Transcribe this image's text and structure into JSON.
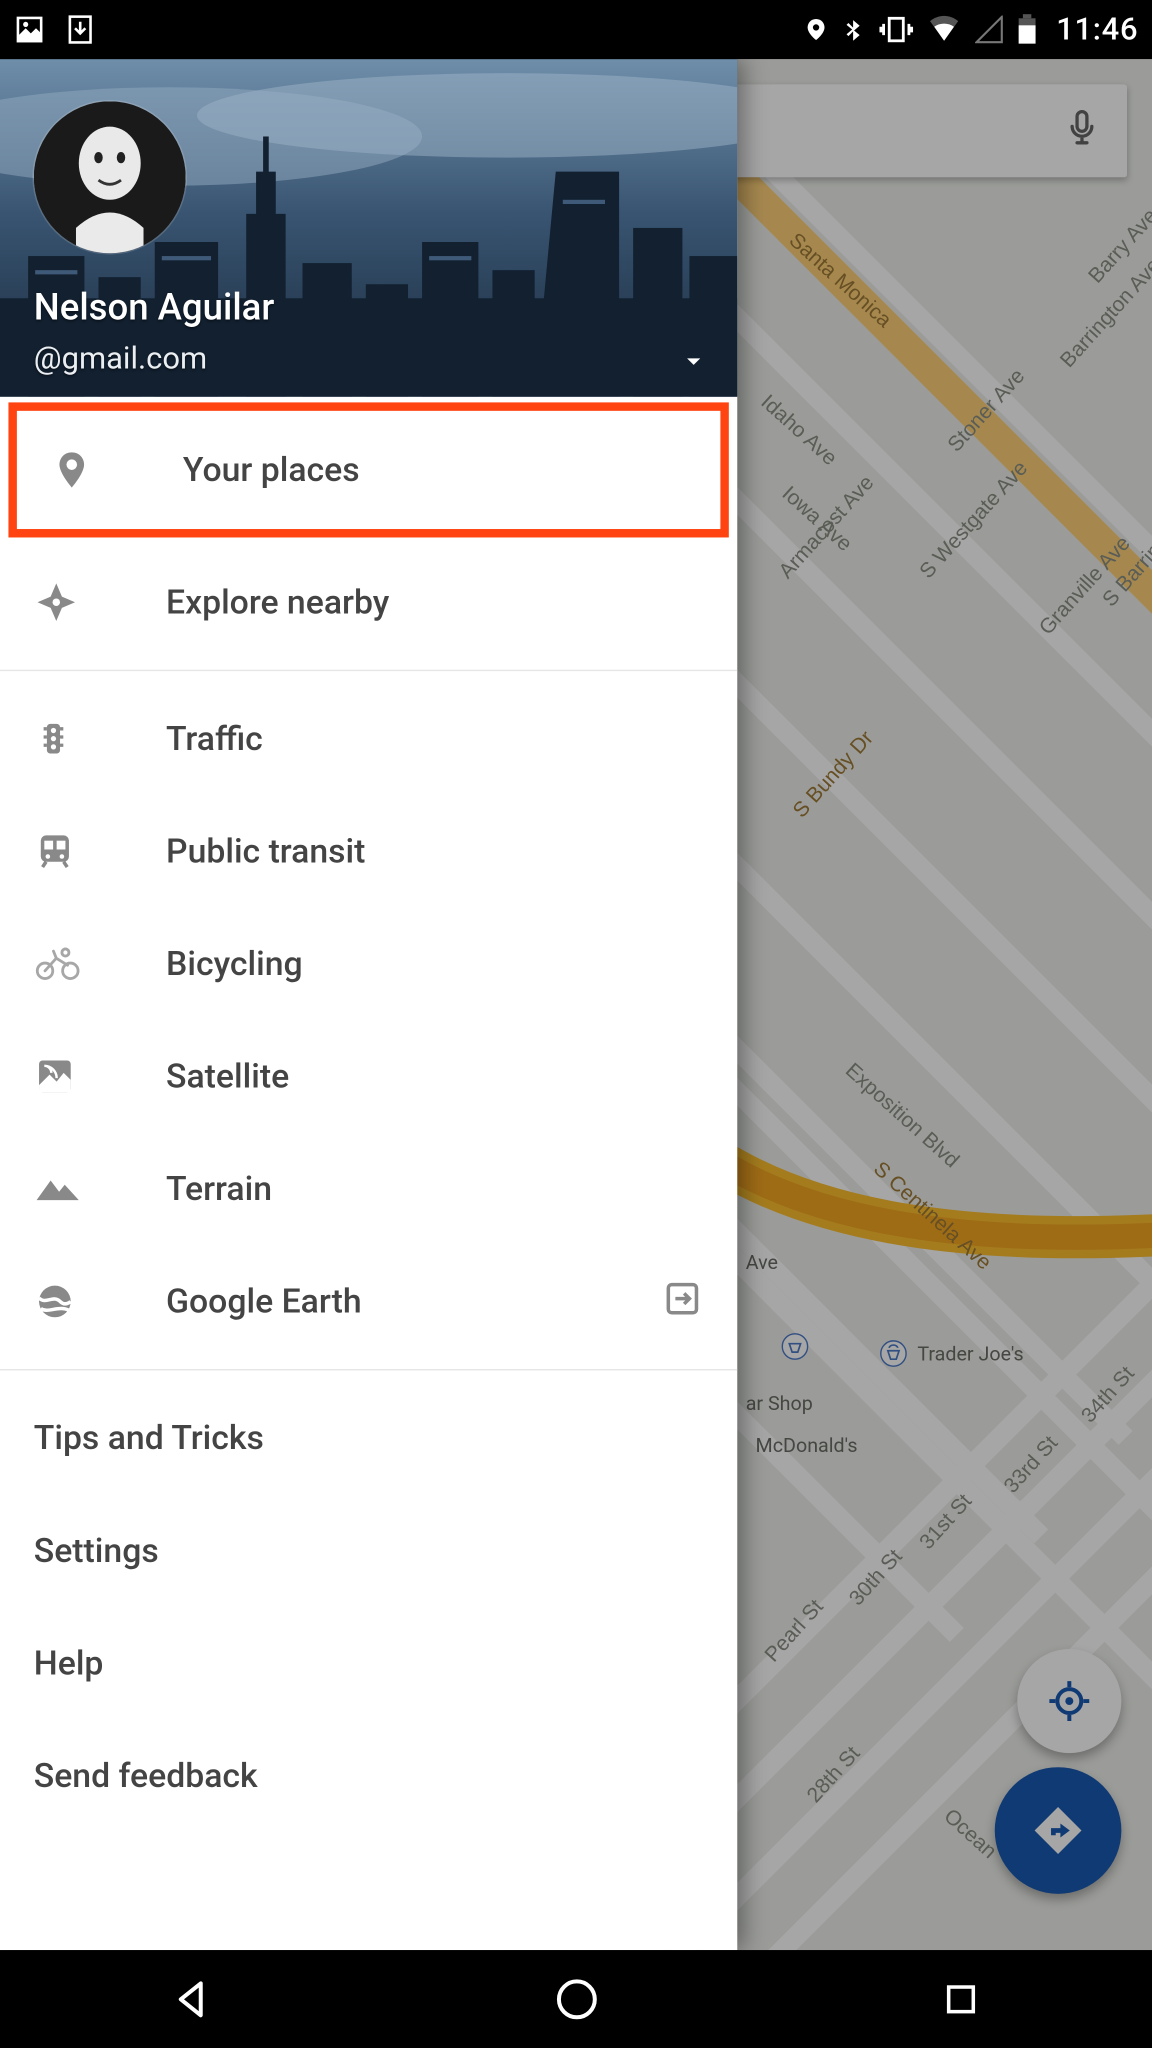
{
  "status_bar": {
    "time": "11:46"
  },
  "account": {
    "name": "Nelson Aguilar",
    "email": "@gmail.com"
  },
  "drawer": {
    "items_primary": [
      {
        "id": "your-places",
        "label": "Your places",
        "icon": "pin",
        "highlight": true
      },
      {
        "id": "explore-nearby",
        "label": "Explore nearby",
        "icon": "compass"
      }
    ],
    "items_layers": [
      {
        "id": "traffic",
        "label": "Traffic",
        "icon": "traffic"
      },
      {
        "id": "public-transit",
        "label": "Public transit",
        "icon": "transit"
      },
      {
        "id": "bicycling",
        "label": "Bicycling",
        "icon": "bike"
      },
      {
        "id": "satellite",
        "label": "Satellite",
        "icon": "satellite"
      },
      {
        "id": "terrain",
        "label": "Terrain",
        "icon": "terrain"
      },
      {
        "id": "google-earth",
        "label": "Google Earth",
        "icon": "earth",
        "external": true
      }
    ],
    "items_settings": [
      {
        "id": "tips",
        "label": "Tips and Tricks"
      },
      {
        "id": "settings",
        "label": "Settings"
      },
      {
        "id": "help",
        "label": "Help"
      },
      {
        "id": "feedback",
        "label": "Send feedback"
      }
    ]
  },
  "map": {
    "streets": [
      "Santa Monica",
      "Idaho Ave",
      "Iowa Ave",
      "Armacost Ave",
      "Stoner Ave",
      "S Westgate Ave",
      "Barrington Ave",
      "Barry Ave",
      "Granville Ave",
      "S Barrington",
      "S Bundy Dr",
      "Exposition Blvd",
      "S Centinela Ave",
      "Pearl St",
      "30th St",
      "31st St",
      "33rd St",
      "34th St",
      "28th St",
      "Ocean"
    ],
    "pois": [
      {
        "name": "Trader Joe's",
        "kind": "shop"
      },
      {
        "name": "ar Shop",
        "kind": "shop"
      },
      {
        "name": "McDonald's",
        "kind": "food"
      }
    ]
  }
}
